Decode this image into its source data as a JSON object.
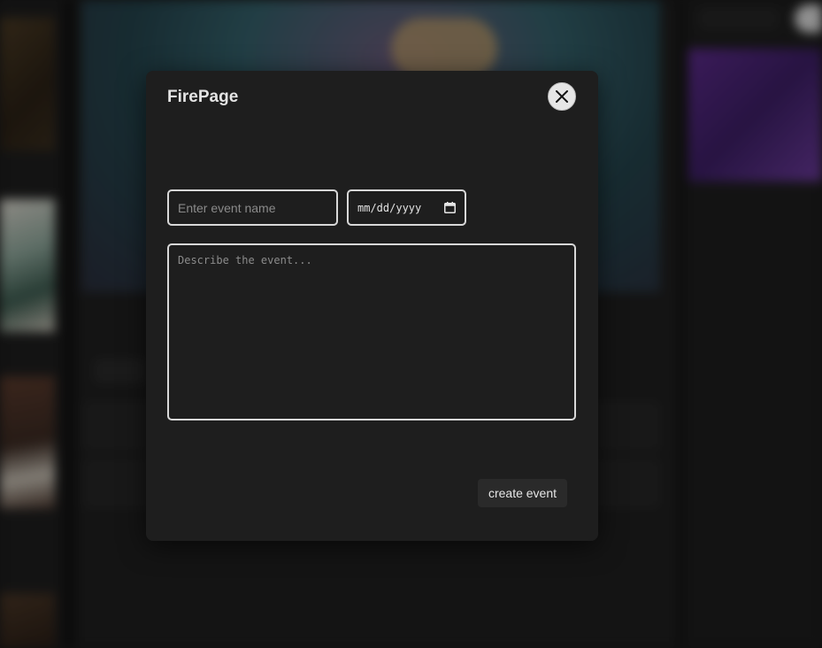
{
  "modal": {
    "title": "FirePage",
    "close_icon": "close-icon",
    "event_name_placeholder": "Enter event name",
    "event_name_value": "",
    "date_placeholder": "mm/dd/yyyy",
    "calendar_icon": "calendar-icon",
    "description_placeholder": "Describe the event...",
    "description_value": "",
    "create_label": "create event"
  },
  "colors": {
    "modal_bg": "#1e1e1e",
    "input_border": "#d8d8d8",
    "button_bg": "#2a2a2a",
    "close_bg": "#e6e6e6"
  }
}
